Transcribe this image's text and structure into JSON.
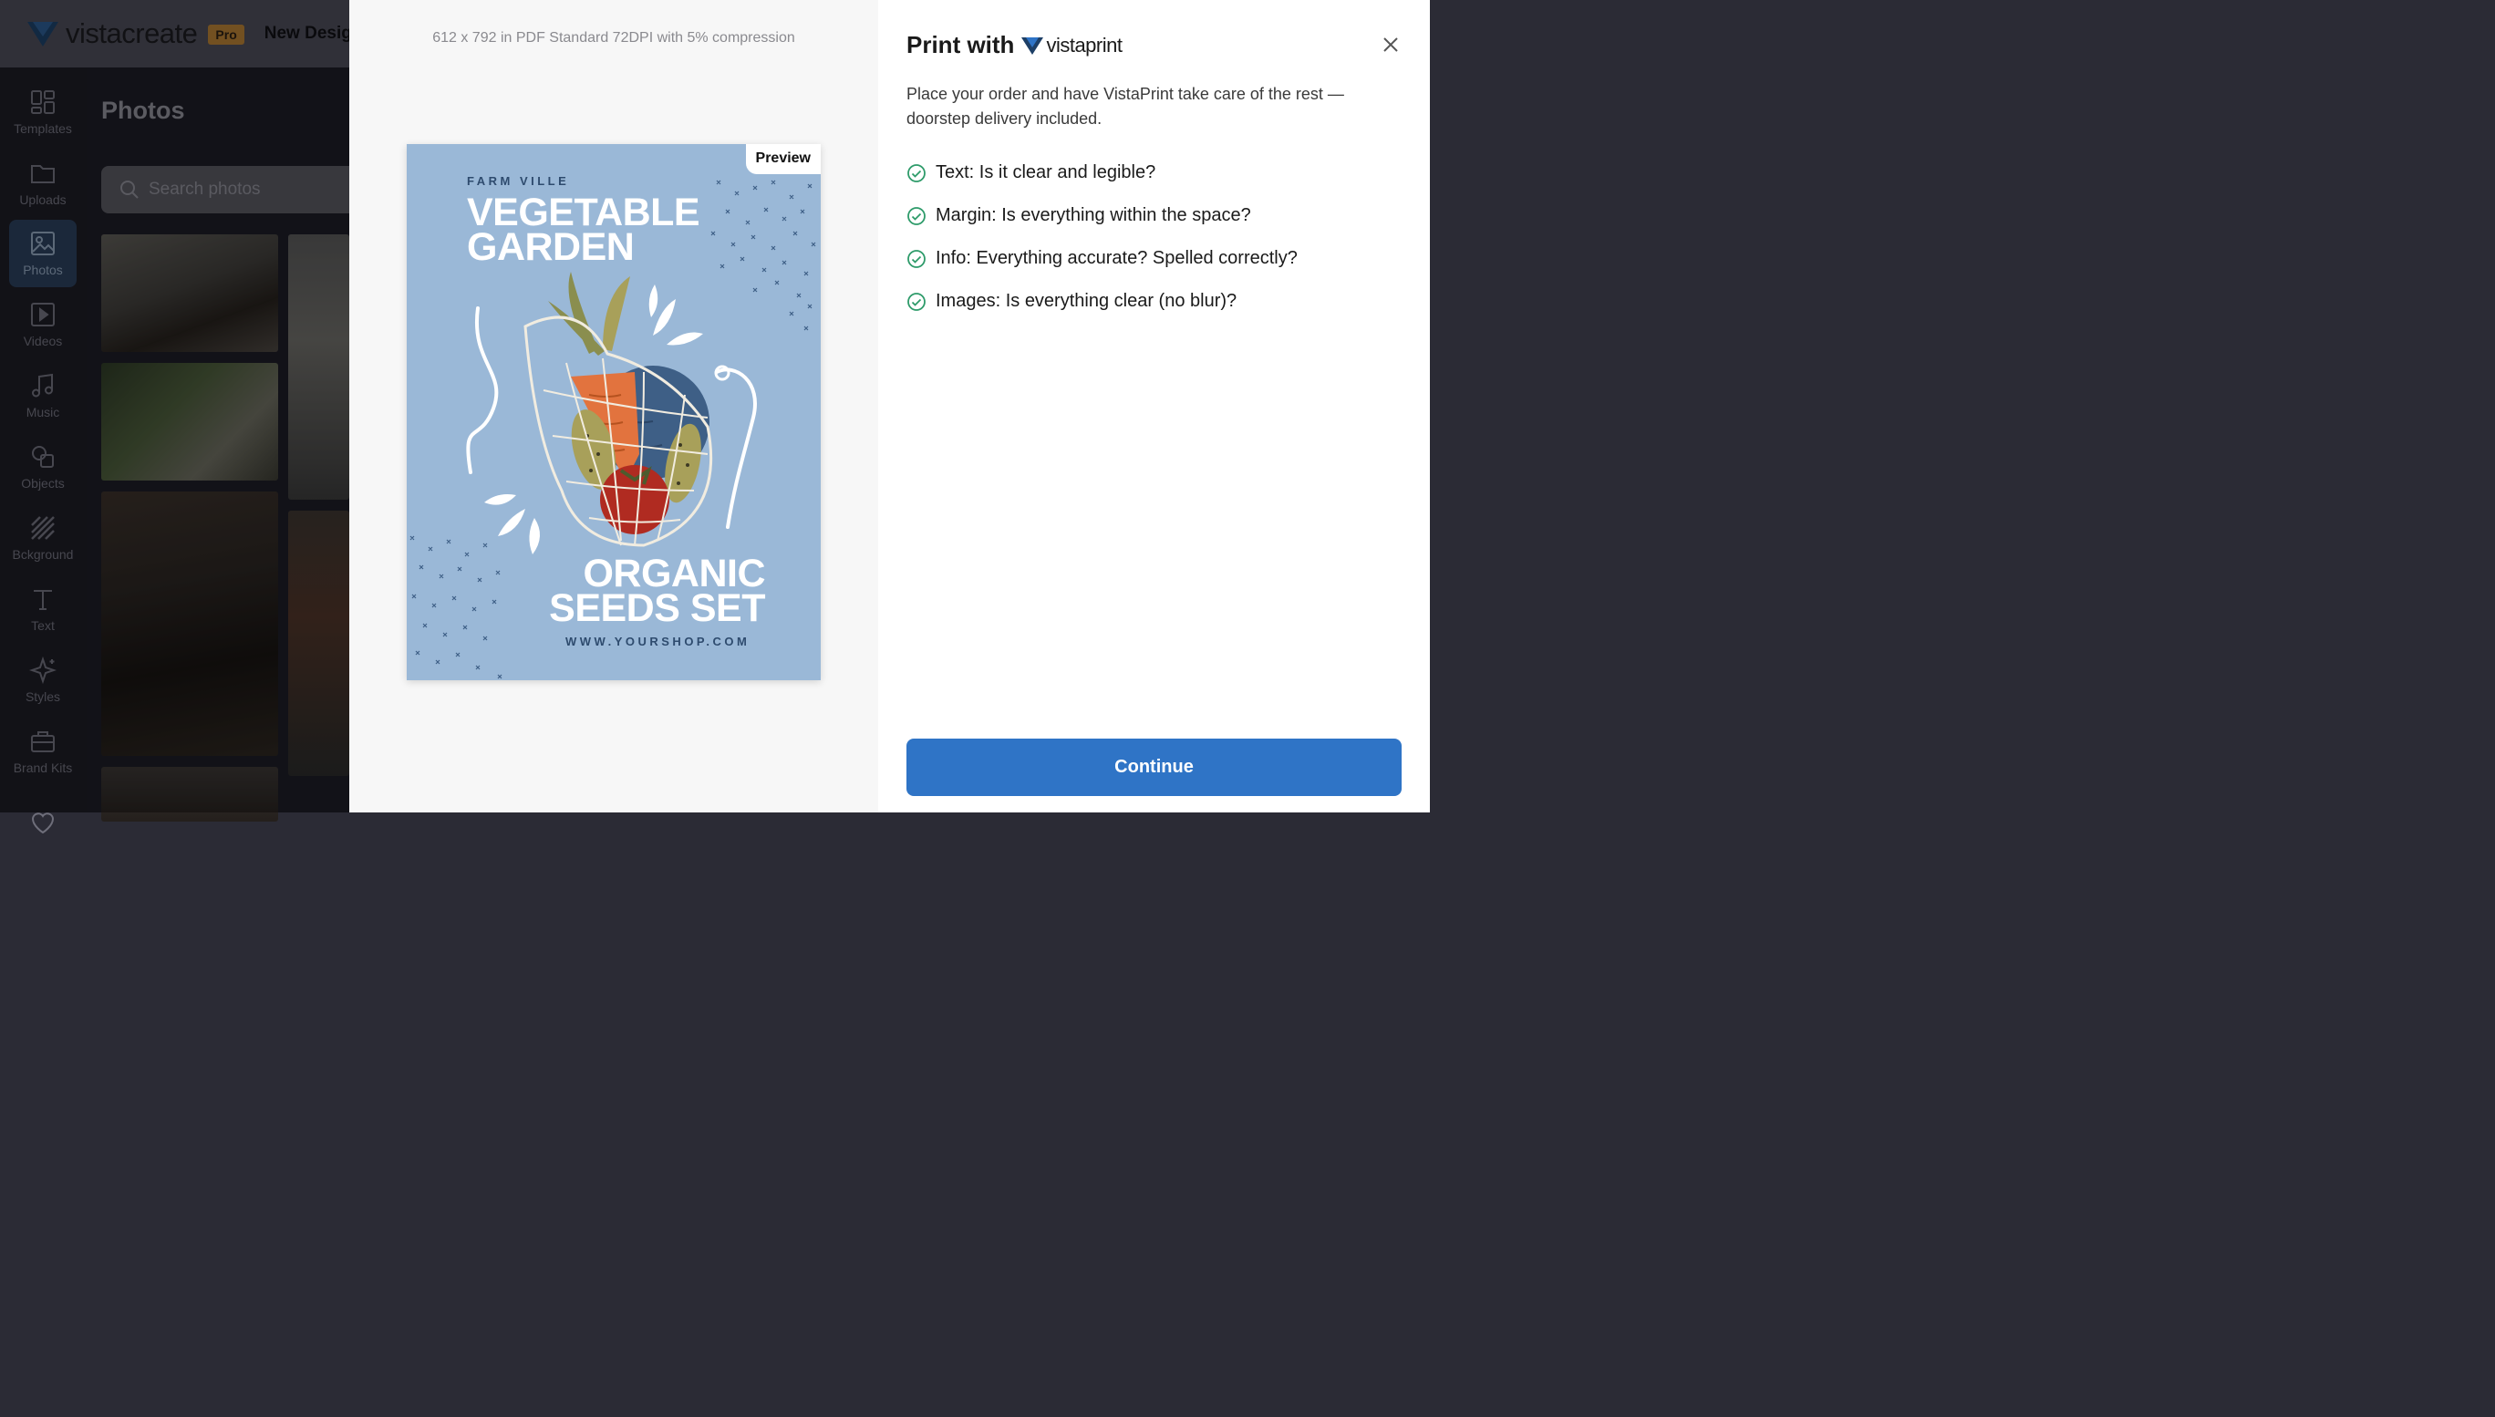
{
  "app": {
    "logo_text": "vistacreate",
    "pro_badge": "Pro",
    "document_title": "New Desig"
  },
  "sidebar": {
    "items": [
      {
        "label": "Templates",
        "icon": "templates-icon"
      },
      {
        "label": "Uploads",
        "icon": "folder-icon"
      },
      {
        "label": "Photos",
        "icon": "image-icon",
        "active": true
      },
      {
        "label": "Videos",
        "icon": "video-icon"
      },
      {
        "label": "Music",
        "icon": "music-icon"
      },
      {
        "label": "Objects",
        "icon": "shapes-icon"
      },
      {
        "label": "Bckground",
        "icon": "background-icon"
      },
      {
        "label": "Text",
        "icon": "text-icon"
      },
      {
        "label": "Styles",
        "icon": "sparkle-icon"
      },
      {
        "label": "Brand Kits",
        "icon": "briefcase-icon"
      }
    ]
  },
  "panel": {
    "title": "Photos",
    "search_placeholder": "Search photos"
  },
  "modal": {
    "spec_text": "612 x 792 in PDF Standard 72DPI with 5% compression",
    "preview_tag": "Preview",
    "poster": {
      "kicker": "FARM VILLE",
      "title_line1": "VEGETABLE",
      "title_line2": "GARDEN",
      "bottom_line1": "ORGANIC",
      "bottom_line2": "SEEDS SET",
      "url": "WWW.YOURSHOP.COM"
    },
    "print_with": "Print with",
    "brand": "vistaprint",
    "description": "Place your order and have VistaPrint take care of the rest — doorstep delivery included.",
    "checklist": [
      "Text: Is it clear and legible?",
      "Margin: Is everything within the space?",
      "Info: Everything accurate? Spelled correctly?",
      "Images: Is everything clear (no blur)?"
    ],
    "continue_label": "Continue"
  },
  "colors": {
    "accent": "#2f74c6",
    "check_green": "#2e9b6a",
    "poster_bg": "#9ab8d7"
  }
}
